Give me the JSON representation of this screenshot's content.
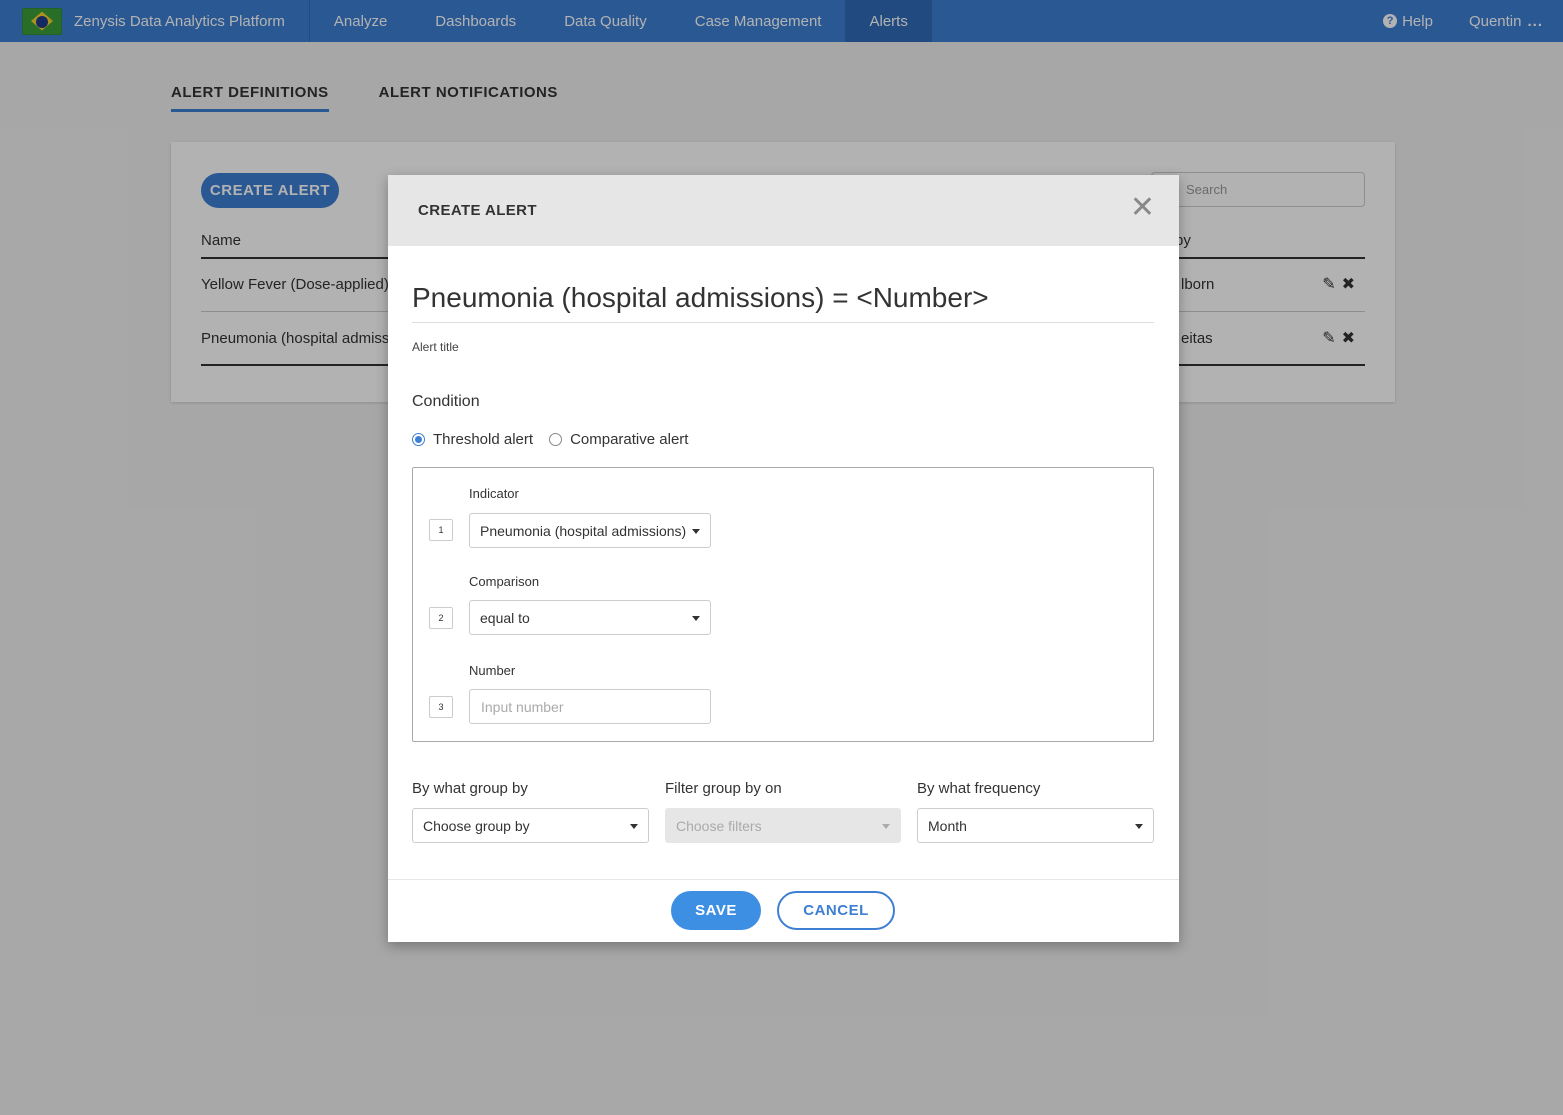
{
  "navbar": {
    "brand": "Zenysis Data Analytics Platform",
    "items": [
      "Analyze",
      "Dashboards",
      "Data Quality",
      "Case Management",
      "Alerts"
    ],
    "active": "Alerts",
    "help": "Help",
    "user": "Quentin",
    "user_menu": "..."
  },
  "tabs": {
    "definitions": "ALERT DEFINITIONS",
    "notifications": "ALERT NOTIFICATIONS"
  },
  "list": {
    "create_button": "CREATE ALERT",
    "search_placeholder": "Search",
    "col_name": "Name",
    "col_by": "by",
    "rows": [
      {
        "name": "Yellow Fever (Dose-applied)",
        "by": "lborn"
      },
      {
        "name": "Pneumonia (hospital admissi",
        "by": "eitas"
      }
    ]
  },
  "modal": {
    "title": "CREATE ALERT",
    "close": "✕",
    "alert_title": "Pneumonia (hospital admissions) = <Number>",
    "alert_title_label": "Alert title",
    "condition_label": "Condition",
    "radio_threshold": "Threshold alert",
    "radio_comparative": "Comparative alert",
    "indicator_label": "Indicator",
    "indicator_value": "Pneumonia (hospital admissions)",
    "comparison_label": "Comparison",
    "comparison_value": "equal to",
    "number_label": "Number",
    "number_placeholder": "Input number",
    "steps": [
      "1",
      "2",
      "3"
    ],
    "group_by_label": "By what group by",
    "group_by_value": "Choose group by",
    "filter_label": "Filter group by on",
    "filter_value": "Choose filters",
    "frequency_label": "By what frequency",
    "frequency_value": "Month",
    "save": "SAVE",
    "cancel": "CANCEL"
  },
  "colors": {
    "primary": "#3d7fd3",
    "navbar": "#3d7fd3",
    "header_bg": "#e6e6e6"
  }
}
